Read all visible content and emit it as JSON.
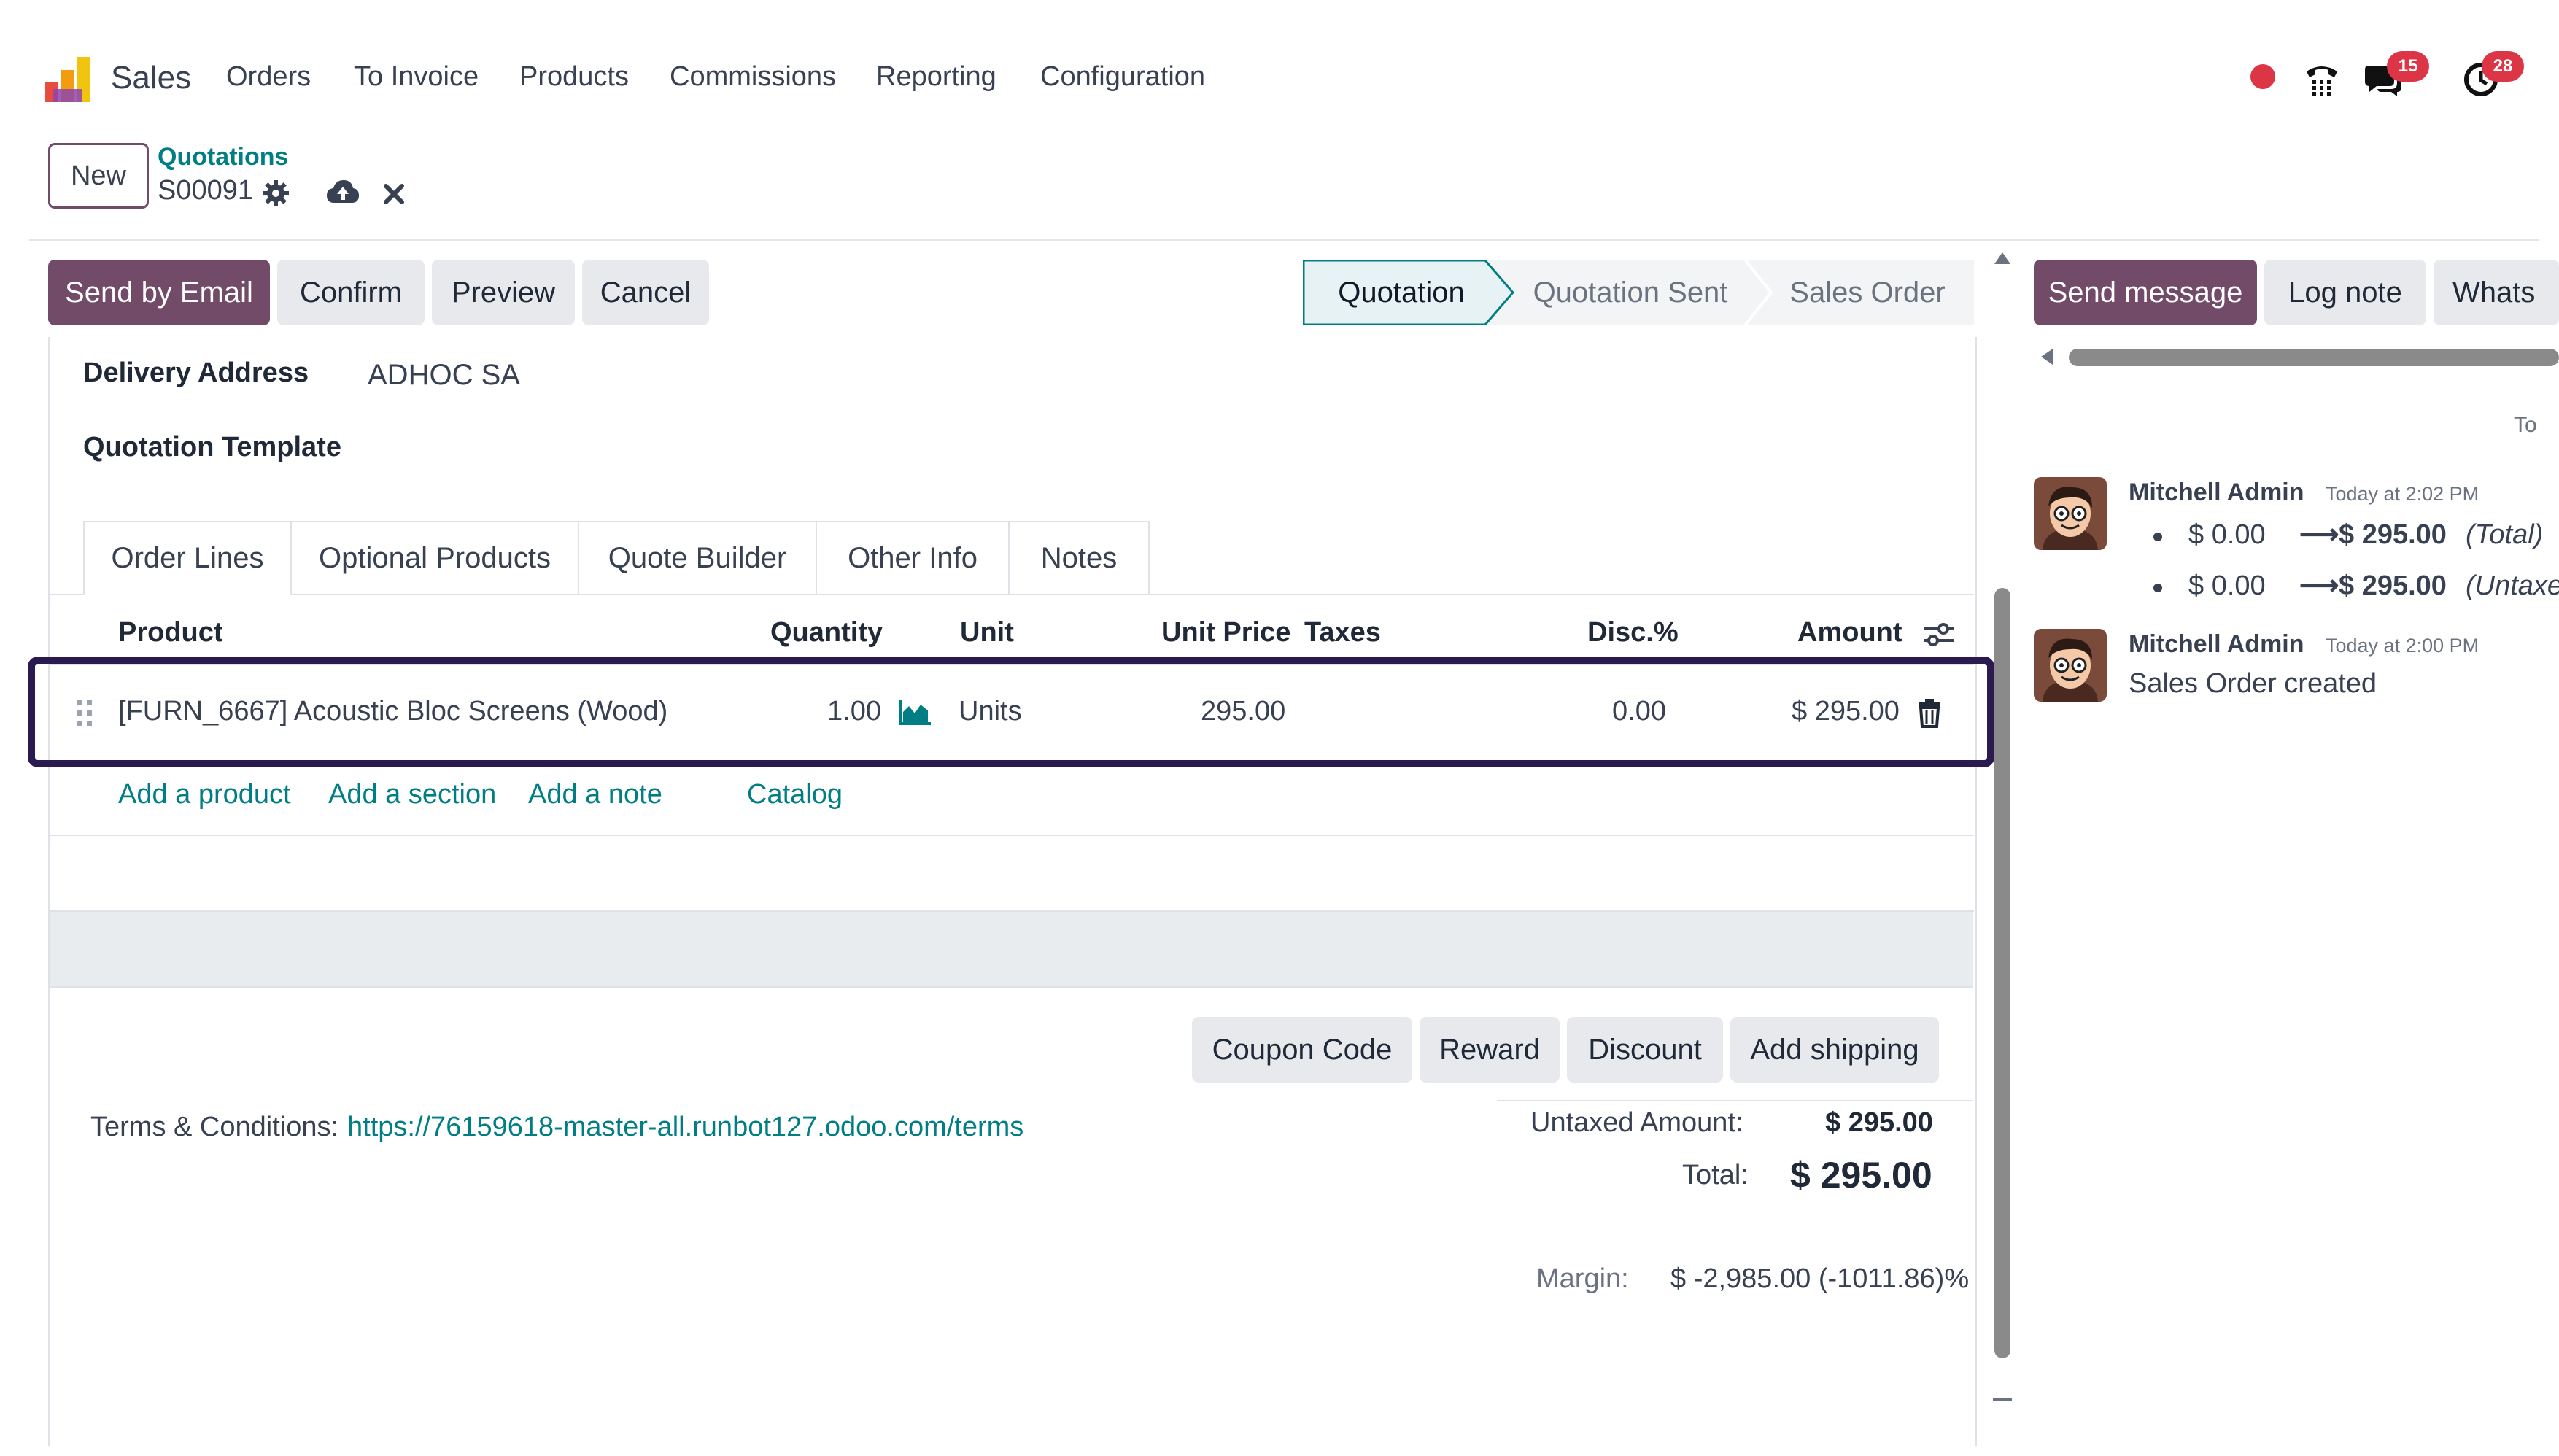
{
  "navbar": {
    "app_name": "Sales",
    "menu": [
      "Orders",
      "To Invoice",
      "Products",
      "Commissions",
      "Reporting",
      "Configuration"
    ],
    "messages_badge": "15",
    "activities_badge": "28"
  },
  "control": {
    "new_label": "New",
    "breadcrumb_parent": "Quotations",
    "record_name": "S00091"
  },
  "actions": {
    "send_by_email": "Send by Email",
    "confirm": "Confirm",
    "preview": "Preview",
    "cancel": "Cancel"
  },
  "status": {
    "steps": [
      "Quotation",
      "Quotation Sent",
      "Sales Order"
    ],
    "active": "Quotation"
  },
  "form": {
    "delivery_address_label": "Delivery Address",
    "delivery_address_value": "ADHOC SA",
    "quotation_template_label": "Quotation Template"
  },
  "tabs": [
    "Order Lines",
    "Optional Products",
    "Quote Builder",
    "Other Info",
    "Notes"
  ],
  "order_lines": {
    "headers": {
      "product": "Product",
      "quantity": "Quantity",
      "unit": "Unit",
      "unit_price": "Unit Price",
      "taxes": "Taxes",
      "discount": "Disc.%",
      "amount": "Amount"
    },
    "rows": [
      {
        "product": "[FURN_6667] Acoustic Bloc Screens (Wood)",
        "quantity": "1.00",
        "unit": "Units",
        "unit_price": "295.00",
        "taxes": "",
        "discount": "0.00",
        "amount": "$ 295.00"
      }
    ],
    "add_product": "Add a product",
    "add_section": "Add a section",
    "add_note": "Add a note",
    "catalog": "Catalog"
  },
  "footer_buttons": {
    "coupon_code": "Coupon Code",
    "reward": "Reward",
    "discount": "Discount",
    "add_shipping": "Add shipping"
  },
  "terms": {
    "label": "Terms & Conditions:",
    "url": "https://76159618-master-all.runbot127.odoo.com/terms"
  },
  "totals": {
    "untaxed_label": "Untaxed Amount:",
    "untaxed_value": "$ 295.00",
    "total_label": "Total:",
    "total_value": "$ 295.00",
    "margin_label": "Margin:",
    "margin_value": "$ -2,985.00 (-1011.86)%"
  },
  "chatter": {
    "send_message": "Send message",
    "log_note": "Log note",
    "whatsapp_partial": "Whats",
    "date_partial": "To",
    "messages": [
      {
        "author": "Mitchell Admin",
        "time": "Today at 2:02 PM",
        "changes": [
          {
            "old": "$ 0.00",
            "new": "$ 295.00",
            "field": "(Total)"
          },
          {
            "old": "$ 0.00",
            "new": "$ 295.00",
            "field": "(Untaxed"
          }
        ]
      },
      {
        "author": "Mitchell Admin",
        "time": "Today at 2:00 PM",
        "body": "Sales Order created"
      }
    ]
  },
  "colors": {
    "primary": "#714B67",
    "link": "#017e84",
    "highlight_border": "#2b1a4f",
    "badge": "#dc3545",
    "record_dot": "#dc3545"
  }
}
